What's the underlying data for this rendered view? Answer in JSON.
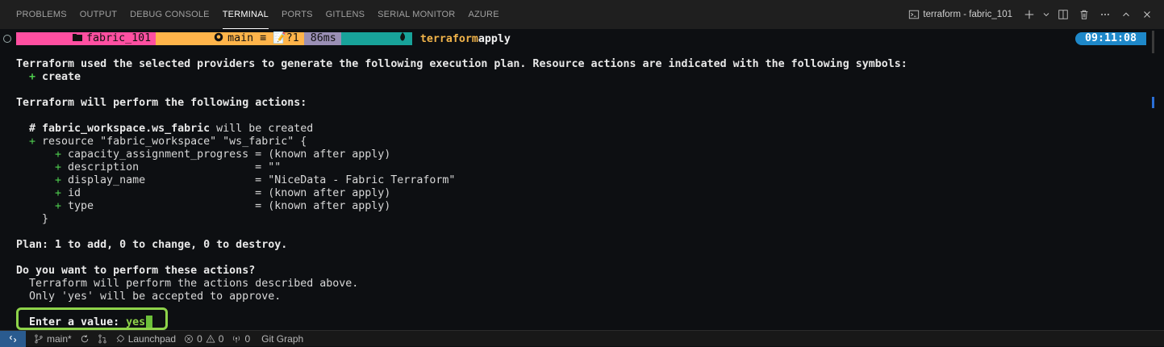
{
  "panel": {
    "tabs": [
      {
        "label": "PROBLEMS"
      },
      {
        "label": "OUTPUT"
      },
      {
        "label": "DEBUG CONSOLE"
      },
      {
        "label": "TERMINAL"
      },
      {
        "label": "PORTS"
      },
      {
        "label": "GITLENS"
      },
      {
        "label": "SERIAL MONITOR"
      },
      {
        "label": "AZURE"
      }
    ],
    "active_tab": "TERMINAL",
    "terminal_name": "terraform - fabric_101"
  },
  "prompt": {
    "folder": "fabric_101",
    "git": "main ≡ 📝?1",
    "duration": "86ms",
    "command_name": "terraform",
    "command_args": " apply",
    "clock": "09:11:08"
  },
  "output": {
    "l1": "Terraform used the selected providers to generate the following execution plan. Resource actions are indicated with the following symbols:",
    "l2_sym": "+",
    "l2_text": " create",
    "l3": "Terraform will perform the following actions:",
    "l4": "# fabric_workspace.ws_fabric",
    "l4b": " will be created",
    "l5_sym": "+",
    "l5_text": " resource \"fabric_workspace\" \"ws_fabric\" {",
    "attrs": [
      {
        "sym": "+",
        "text": " capacity_assignment_progress = (known after apply)"
      },
      {
        "sym": "+",
        "text": " description                  = \"\""
      },
      {
        "sym": "+",
        "text": " display_name                 = \"NiceData - Fabric Terraform\""
      },
      {
        "sym": "+",
        "text": " id                           = (known after apply)"
      },
      {
        "sym": "+",
        "text": " type                         = (known after apply)"
      }
    ],
    "close_brace": "}",
    "plan": "Plan: 1 to add, 0 to change, 0 to destroy.",
    "question": "Do you want to perform these actions?",
    "q1": "Terraform will perform the actions described above.",
    "q2": "Only 'yes' will be accepted to approve.",
    "enter_label": "Enter a value: ",
    "enter_value": "yes"
  },
  "statusbar": {
    "branch": "main*",
    "launchpad": "Launchpad",
    "errors": "0",
    "warnings": "0",
    "ports": "0",
    "git_graph": "Git Graph"
  },
  "colors": {
    "accent_green": "#8ed34a",
    "clock_blue": "#1e88c9",
    "folder_pink": "#ff4fa1",
    "git_orange": "#ffb44a"
  }
}
